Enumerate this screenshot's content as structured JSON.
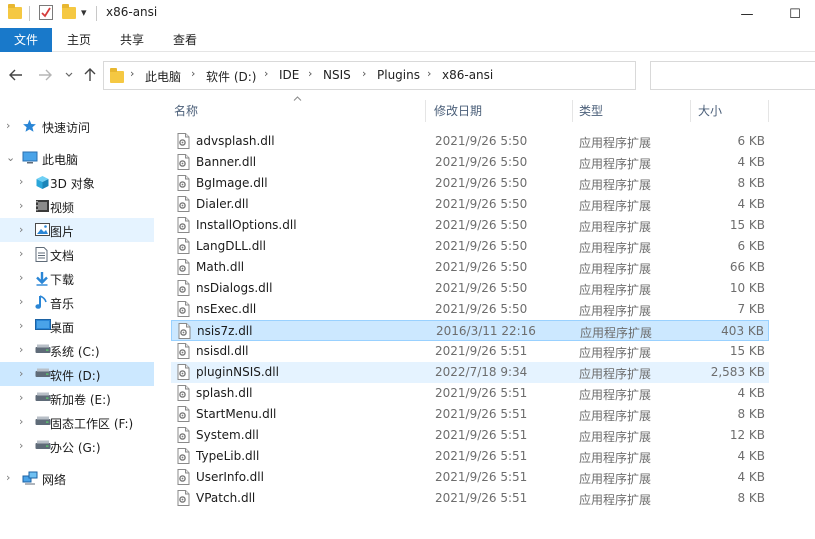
{
  "window": {
    "title": "x86-ansi",
    "quick_access_dropdown": "▾",
    "minimize": "—",
    "maximize": "☐"
  },
  "ribbon": {
    "tabs": [
      {
        "label": "文件",
        "active": true
      },
      {
        "label": "主页"
      },
      {
        "label": "共享"
      },
      {
        "label": "查看"
      }
    ]
  },
  "address": {
    "segments": [
      "此电脑",
      "软件 (D:)",
      "IDE",
      "NSIS",
      "Plugins",
      "x86-ansi"
    ],
    "search_placeholder": ""
  },
  "nav": {
    "items": [
      {
        "label": "快速访问",
        "icon": "star-icon",
        "level": 0,
        "expander": "›"
      },
      {
        "label": "此电脑",
        "icon": "computer-icon",
        "level": 0,
        "expander": "⌄",
        "expanded": true
      },
      {
        "label": "3D 对象",
        "icon": "cube-icon",
        "level": 1,
        "expander": "›"
      },
      {
        "label": "视频",
        "icon": "video-icon",
        "level": 1,
        "expander": "›"
      },
      {
        "label": "图片",
        "icon": "picture-icon",
        "level": 1,
        "expander": "›",
        "state": "hover"
      },
      {
        "label": "文档",
        "icon": "document-icon",
        "level": 1,
        "expander": "›"
      },
      {
        "label": "下载",
        "icon": "download-icon",
        "level": 1,
        "expander": "›"
      },
      {
        "label": "音乐",
        "icon": "music-icon",
        "level": 1,
        "expander": "›"
      },
      {
        "label": "桌面",
        "icon": "desktop-icon",
        "level": 1,
        "expander": "›"
      },
      {
        "label": "系统 (C:)",
        "icon": "drive-icon",
        "level": 1,
        "expander": "›"
      },
      {
        "label": "软件 (D:)",
        "icon": "drive-icon",
        "level": 1,
        "expander": "›",
        "state": "selected"
      },
      {
        "label": "新加卷 (E:)",
        "icon": "drive-icon",
        "level": 1,
        "expander": "›"
      },
      {
        "label": "固态工作区 (F:)",
        "icon": "drive-icon",
        "level": 1,
        "expander": "›"
      },
      {
        "label": "办公 (G:)",
        "icon": "drive-icon",
        "level": 1,
        "expander": "›"
      },
      {
        "label": "网络",
        "icon": "network-icon",
        "level": 0,
        "expander": "›"
      }
    ]
  },
  "columns": {
    "name": "名称",
    "date": "修改日期",
    "type": "类型",
    "size": "大小"
  },
  "files": [
    {
      "name": "advsplash.dll",
      "date": "2021/9/26 5:50",
      "type": "应用程序扩展",
      "size": "6 KB"
    },
    {
      "name": "Banner.dll",
      "date": "2021/9/26 5:50",
      "type": "应用程序扩展",
      "size": "4 KB"
    },
    {
      "name": "BgImage.dll",
      "date": "2021/9/26 5:50",
      "type": "应用程序扩展",
      "size": "8 KB"
    },
    {
      "name": "Dialer.dll",
      "date": "2021/9/26 5:50",
      "type": "应用程序扩展",
      "size": "4 KB"
    },
    {
      "name": "InstallOptions.dll",
      "date": "2021/9/26 5:50",
      "type": "应用程序扩展",
      "size": "15 KB"
    },
    {
      "name": "LangDLL.dll",
      "date": "2021/9/26 5:50",
      "type": "应用程序扩展",
      "size": "6 KB"
    },
    {
      "name": "Math.dll",
      "date": "2021/9/26 5:50",
      "type": "应用程序扩展",
      "size": "66 KB"
    },
    {
      "name": "nsDialogs.dll",
      "date": "2021/9/26 5:50",
      "type": "应用程序扩展",
      "size": "10 KB"
    },
    {
      "name": "nsExec.dll",
      "date": "2021/9/26 5:50",
      "type": "应用程序扩展",
      "size": "7 KB"
    },
    {
      "name": "nsis7z.dll",
      "date": "2016/3/11 22:16",
      "type": "应用程序扩展",
      "size": "403 KB",
      "state": "selected"
    },
    {
      "name": "nsisdl.dll",
      "date": "2021/9/26 5:51",
      "type": "应用程序扩展",
      "size": "15 KB"
    },
    {
      "name": "pluginNSIS.dll",
      "date": "2022/7/18 9:34",
      "type": "应用程序扩展",
      "size": "2,583 KB",
      "state": "hover"
    },
    {
      "name": "splash.dll",
      "date": "2021/9/26 5:51",
      "type": "应用程序扩展",
      "size": "4 KB"
    },
    {
      "name": "StartMenu.dll",
      "date": "2021/9/26 5:51",
      "type": "应用程序扩展",
      "size": "8 KB"
    },
    {
      "name": "System.dll",
      "date": "2021/9/26 5:51",
      "type": "应用程序扩展",
      "size": "12 KB"
    },
    {
      "name": "TypeLib.dll",
      "date": "2021/9/26 5:51",
      "type": "应用程序扩展",
      "size": "4 KB"
    },
    {
      "name": "UserInfo.dll",
      "date": "2021/9/26 5:51",
      "type": "应用程序扩展",
      "size": "4 KB"
    },
    {
      "name": "VPatch.dll",
      "date": "2021/9/26 5:51",
      "type": "应用程序扩展",
      "size": "8 KB"
    }
  ],
  "colors": {
    "accent": "#1979ca",
    "selected_bg": "#cce8ff",
    "hover_bg": "#e5f3ff",
    "folder": "#f5c842"
  }
}
